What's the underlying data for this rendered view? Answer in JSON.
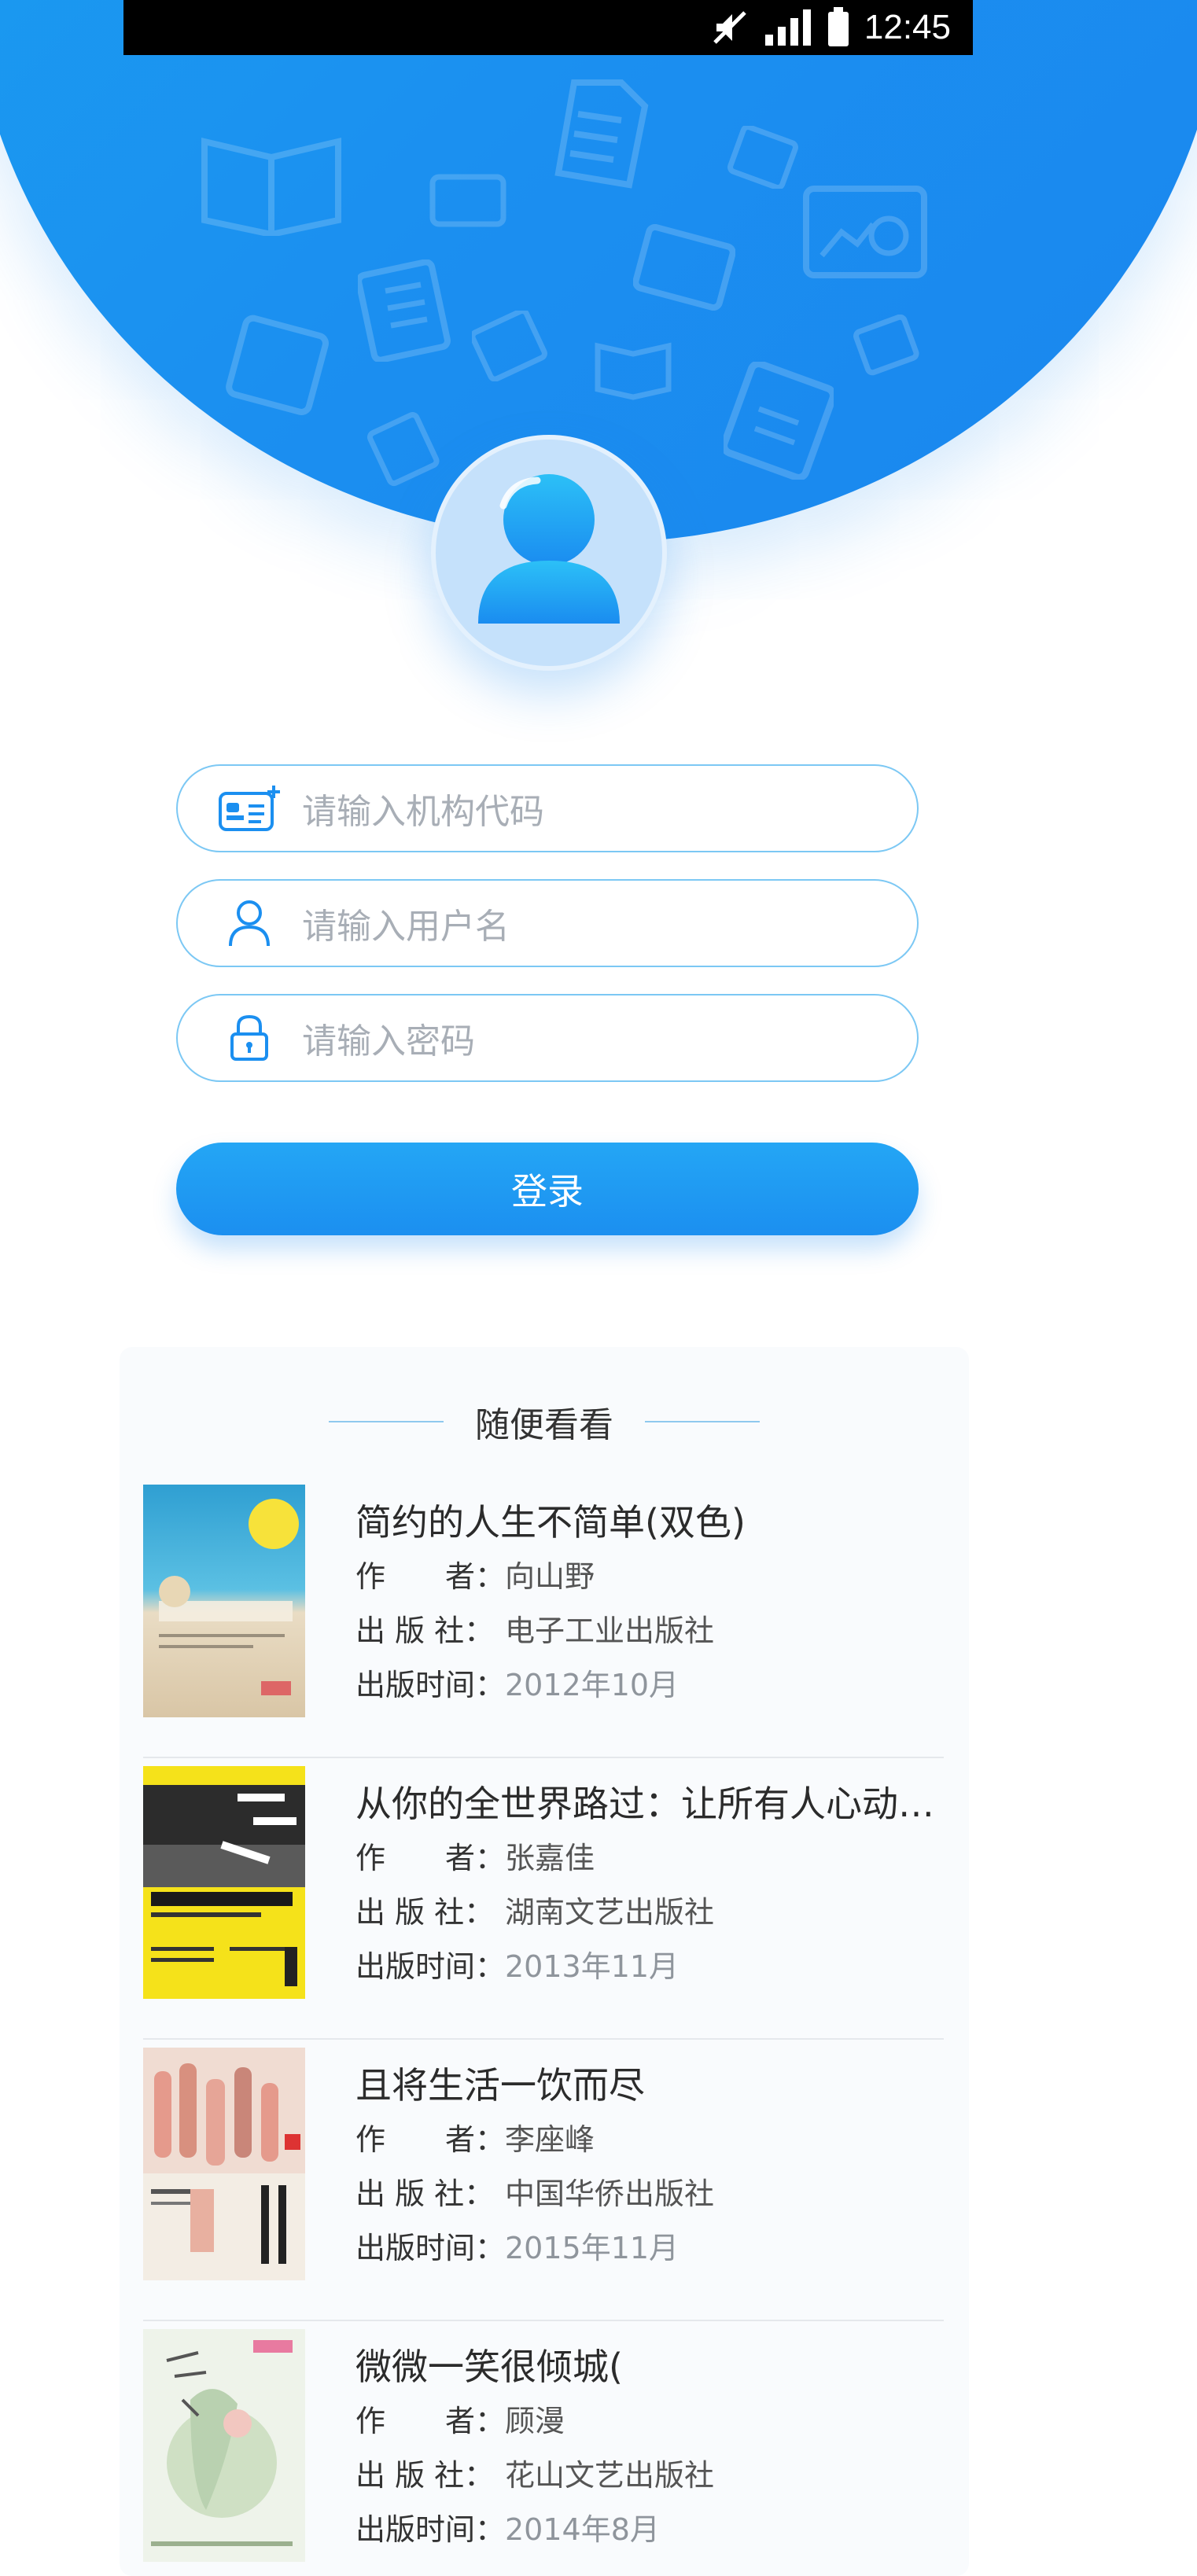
{
  "status_bar": {
    "time": "12:45",
    "icons": [
      "mute-icon",
      "signal-icon",
      "battery-icon"
    ]
  },
  "login": {
    "org_code_placeholder": "请输入机构代码",
    "username_placeholder": "请输入用户名",
    "password_placeholder": "请输入密码",
    "submit_label": "登录"
  },
  "colors": {
    "brand_blue": "#1b8ff0",
    "input_border": "#7cc8f4"
  },
  "books": {
    "section_title": "随便看看",
    "labels": {
      "author": "作　　者：",
      "publisher": "出 版 社：",
      "date": "出版时间："
    },
    "items": [
      {
        "title": "简约的人生不简单(双色)",
        "author": "向山野",
        "publisher": "电子工业出版社",
        "date": "2012年10月"
      },
      {
        "title": "从你的全世界路过：让所有人心动的故事",
        "author": "张嘉佳",
        "publisher": "湖南文艺出版社",
        "date": "2013年11月"
      },
      {
        "title": "且将生活一饮而尽",
        "author": "李座峰",
        "publisher": "中国华侨出版社",
        "date": "2015年11月"
      },
      {
        "title": "微微一笑很倾城(",
        "author": "顾漫",
        "publisher": "花山文艺出版社",
        "date": "2014年8月"
      }
    ]
  }
}
